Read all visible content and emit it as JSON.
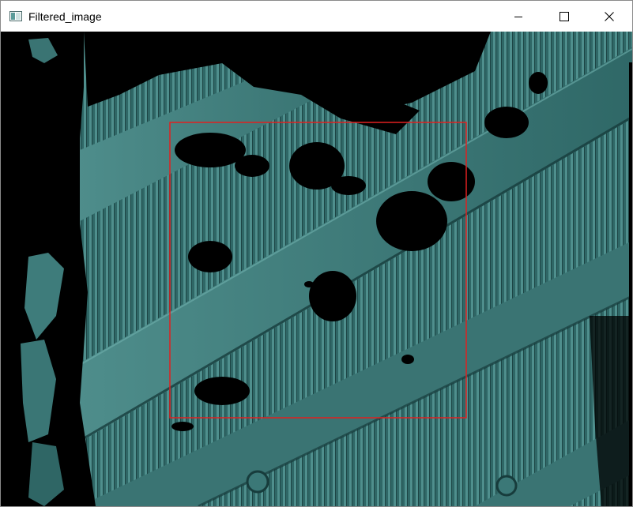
{
  "window": {
    "title": "Filtered_image",
    "controls": {
      "minimize": "minimize",
      "maximize": "maximize",
      "close": "close"
    }
  },
  "icons": {
    "app": "image-window-icon",
    "minimize": "minimize-icon",
    "maximize": "maximize-icon",
    "close": "close-icon"
  },
  "colors": {
    "image_teal": "#3d7b7a",
    "image_teal_light": "#5e9c9a",
    "image_teal_dark": "#2a5a5a",
    "roi_rectangle": "#e02020",
    "background_black": "#000000"
  }
}
